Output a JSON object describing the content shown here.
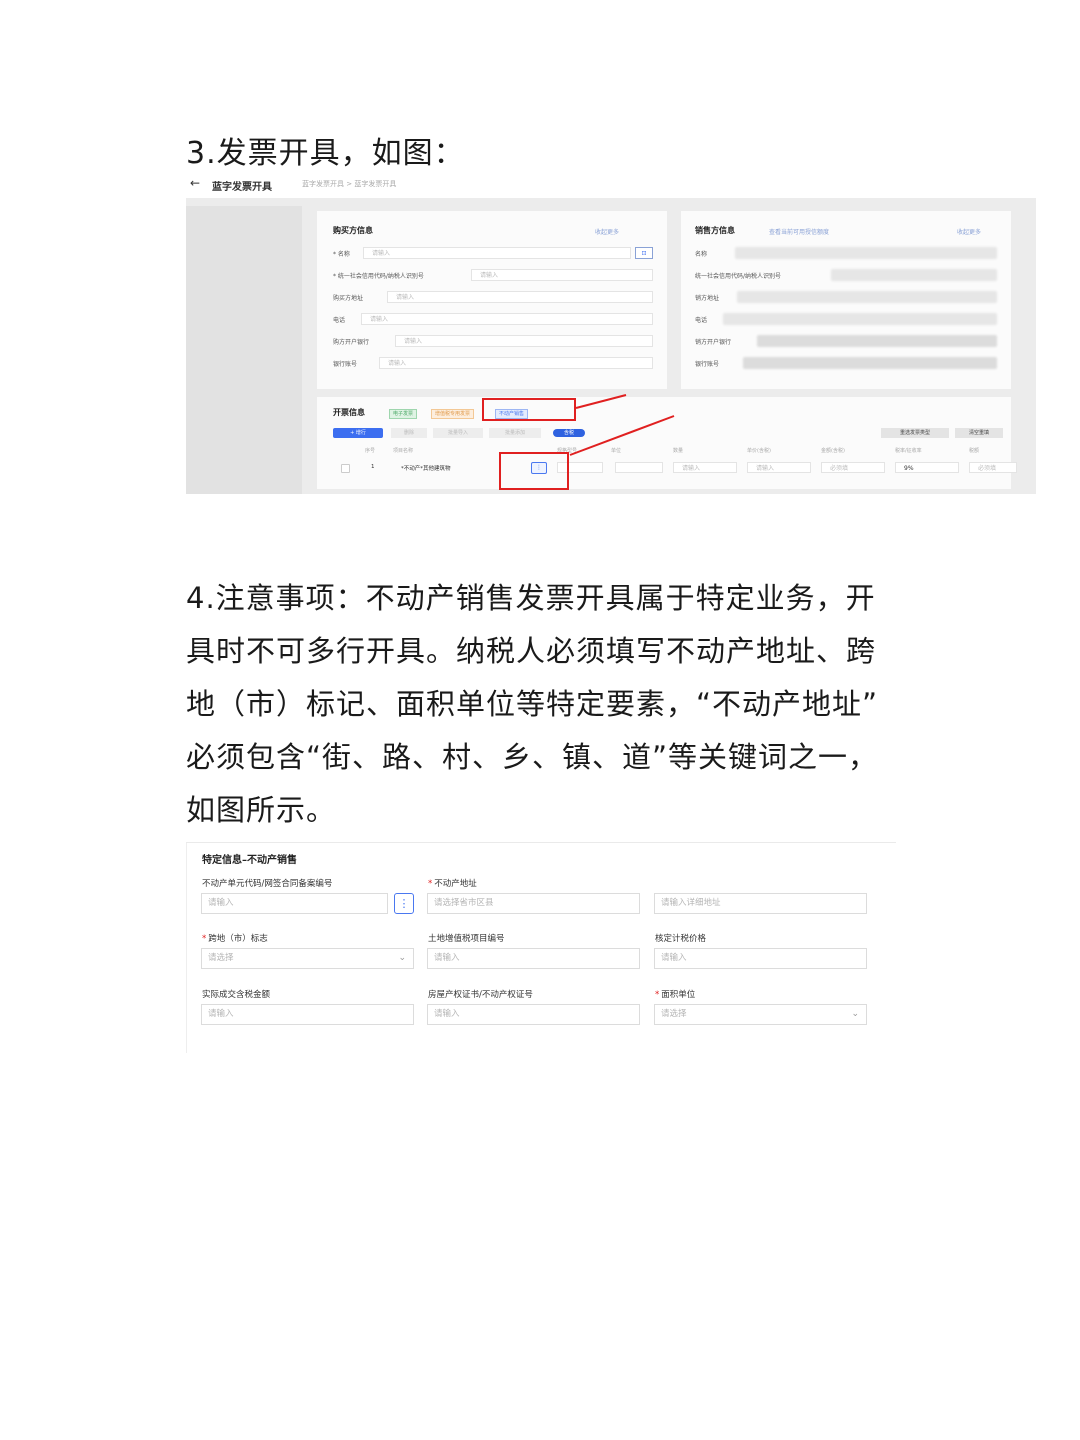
{
  "heading_3": "3.发票开具，如图：",
  "screenshot1": {
    "back_icon": "arrow-left-icon",
    "page_title": "蓝字发票开具",
    "breadcrumb": "蓝字发票开具 > 蓝字发票开具",
    "buyer": {
      "title": "购买方信息",
      "collapse": "收起更多",
      "fields": [
        {
          "label": "* 名称",
          "placeholder": "请输入"
        },
        {
          "label": "* 统一社会信用代码/纳税人识别号",
          "placeholder": "请输入"
        },
        {
          "label": "购买方地址",
          "placeholder": "请输入"
        },
        {
          "label": "电话",
          "placeholder": "请输入"
        },
        {
          "label": "购方开户银行",
          "placeholder": "请输入"
        },
        {
          "label": "银行账号",
          "placeholder": "请输入"
        }
      ]
    },
    "seller": {
      "title": "销售方信息",
      "link": "查看当前可用授信额度",
      "collapse": "收起更多",
      "fields": [
        {
          "label": "名称"
        },
        {
          "label": "统一社会信用代码/纳税人识别号"
        },
        {
          "label": "销方地址"
        },
        {
          "label": "电话"
        },
        {
          "label": "销方开户银行"
        },
        {
          "label": "银行账号"
        }
      ]
    },
    "invoice": {
      "title": "开票信息",
      "tags": [
        "电子发票",
        "增值税专用发票",
        "不动产销售"
      ],
      "toolbar": [
        "+ 增行",
        "删除",
        "批量导入",
        "批量添加",
        "含税"
      ],
      "right_buttons": [
        "重选发票类型",
        "清空重填"
      ],
      "columns": [
        "序号",
        "项目名称",
        "规格型号",
        "单位",
        "数量",
        "单价(含税)",
        "金额(含税)",
        "税率/征收率",
        "税额"
      ],
      "row": {
        "index": "1",
        "item": "*不动产*其他建筑物",
        "qty_placeholder": "请输入",
        "price_placeholder": "请输入",
        "amount_placeholder": "必须填",
        "rate": "9%",
        "tax_placeholder": "必须填"
      }
    }
  },
  "paragraph": [
    "4.注意事项：不动产销售发票开具属于特定业务，开",
    "具时不可多行开具。纳税人必须填写不动产地址、跨",
    "地（市）标记、面积单位等特定要素，“不动产地址”",
    "必须包含“街、路、村、乡、镇、道”等关键词之一，",
    "如图所示。"
  ],
  "screenshot2": {
    "title": "特定信息–不动产销售",
    "fields": {
      "unit_code": {
        "label": "不动产单元代码/网签合同备案编号",
        "placeholder": "请输入"
      },
      "address": {
        "label": "不动产地址",
        "required": "*",
        "placeholder_region": "请选择省市区县",
        "placeholder_detail": "请输入详细地址"
      },
      "cross_city": {
        "label": "跨地（市）标志",
        "required": "*",
        "placeholder": "请选择"
      },
      "land_vat": {
        "label": "土地增值税项目编号",
        "placeholder": "请输入"
      },
      "assessed_price": {
        "label": "核定计税价格",
        "placeholder": "请输入"
      },
      "actual_tax": {
        "label": "实际成交含税金额",
        "placeholder": "请输入"
      },
      "cert_no": {
        "label": "房屋产权证书/不动产权证号",
        "placeholder": "请输入"
      },
      "area_unit": {
        "label": "面积单位",
        "required": "*",
        "placeholder": "请选择"
      }
    },
    "select_icon": "more-vertical-icon",
    "chevron_icon": "chevron-down-icon"
  },
  "colors": {
    "red_annotation": "#e02020",
    "primary_blue": "#3c6ef0"
  }
}
